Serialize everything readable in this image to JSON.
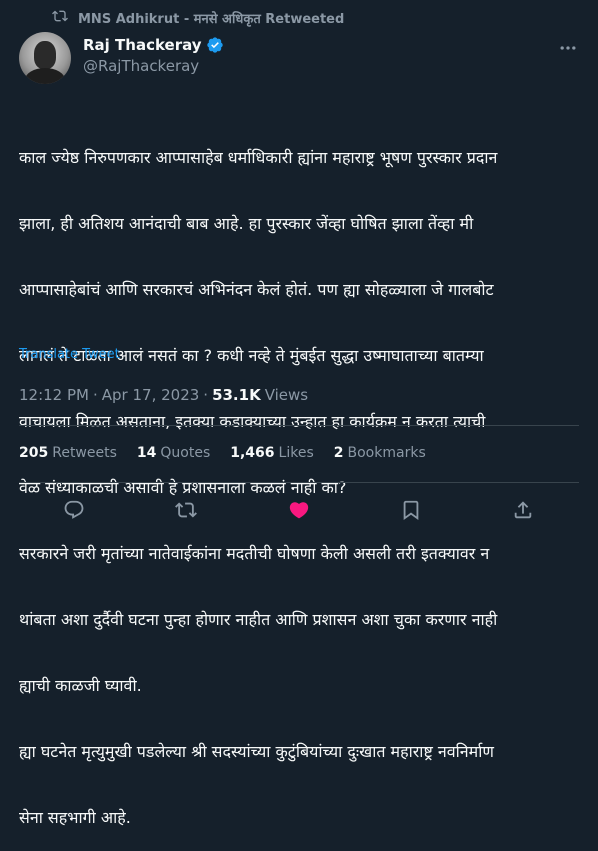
{
  "retweet_banner": {
    "text": "MNS Adhikrut - मनसे अधिकृत Retweeted",
    "icon": "retweet-icon"
  },
  "author": {
    "display_name": "Raj Thackeray",
    "handle": "@RajThackeray",
    "verified": true,
    "avatar_icon": "avatar"
  },
  "tweet": {
    "lines": [
      "काल ज्येष्ठ निरुपणकार आप्पासाहेब धर्माधिकारी ह्यांना महाराष्ट्र भूषण पुरस्कार प्रदान",
      "झाला, ही अतिशय आनंदाची बाब आहे. हा पुरस्कार जेंव्हा घोषित झाला तेंव्हा मी",
      "आप्पासाहेबांचं आणि सरकारचं अभिनंदन केलं होतं. पण ह्या सोहळ्याला जे गालबोट",
      "लागलं ते टाळता आलं नसतं का ? कधी नव्हे ते मुंबईत सुद्धा उष्माघाताच्या बातम्या",
      "वाचायला मिळत असताना, इतक्या कडाक्याच्या उन्हात हा कार्यक्रम न करता त्याची",
      "वेळ संध्याकाळची असावी हे प्रशासनाला कळलं नाही का?",
      "सरकारने जरी मृतांच्या नातेवाईकांना मदतीची घोषणा केली असली तरी इतक्यावर न",
      "थांबता अशा दुर्दैवी घटना पुन्हा होणार नाहीत आणि प्रशासन अशा चुका करणार नाही",
      "ह्याची काळजी घ्यावी.",
      "ह्या घटनेत मृत्युमुखी पडलेल्या श्री सदस्यांच्या कुटुंबियांच्या दुःखात महाराष्ट्र नवनिर्माण",
      "सेना सहभागी आहे."
    ],
    "translate_label": "Translate Tweet"
  },
  "meta": {
    "time": "12:12 PM",
    "separator": "·",
    "date": "Apr 17, 2023",
    "separator2": "·",
    "views_count": "53.1K",
    "views_label": "Views"
  },
  "stats": [
    {
      "count": "205",
      "label": "Retweets"
    },
    {
      "count": "14",
      "label": "Quotes"
    },
    {
      "count": "1,466",
      "label": "Likes"
    },
    {
      "count": "2",
      "label": "Bookmarks"
    }
  ],
  "actions": [
    {
      "name": "reply-icon"
    },
    {
      "name": "retweet-icon"
    },
    {
      "name": "like-icon",
      "active": true,
      "color": "#f91880"
    },
    {
      "name": "bookmark-icon"
    },
    {
      "name": "share-icon"
    }
  ],
  "colors": {
    "background": "#15202b",
    "text": "#f7f9f9",
    "muted": "#8b98a5",
    "link": "#1d9bf0",
    "like": "#f91880",
    "divider": "#38444d"
  }
}
